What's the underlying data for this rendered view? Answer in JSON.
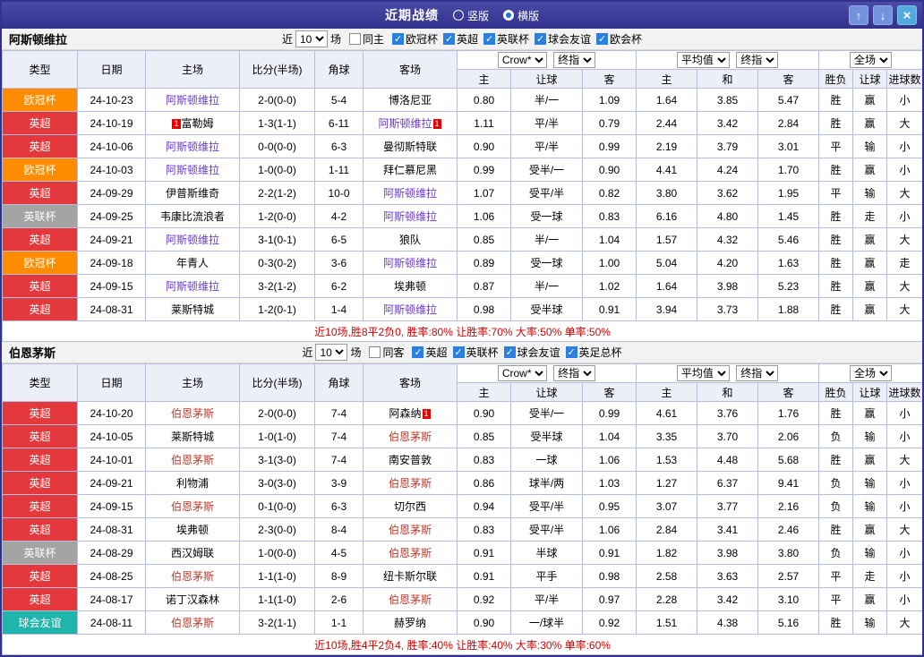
{
  "titlebar": {
    "title": "近期战绩",
    "radios": [
      {
        "label": "竖版",
        "checked": false
      },
      {
        "label": "横版",
        "checked": true
      }
    ],
    "icons": {
      "up": "↑",
      "down": "↓",
      "close": "×"
    }
  },
  "headers": {
    "type": "类型",
    "date": "日期",
    "home": "主场",
    "score": "比分(半场)",
    "corner": "角球",
    "away": "客场",
    "odds_home": "主",
    "odds_handicap": "让球",
    "odds_away": "客",
    "avg_home": "主",
    "avg_draw": "和",
    "avg_away": "客",
    "res_wl": "胜负",
    "res_handicap": "让球",
    "res_goals": "进球数"
  },
  "type_colors": {
    "欧冠杯": "#ff8c00",
    "英超": "#e4393c",
    "英联杯": "#a4a4a4",
    "球会友谊": "#1fb5ad"
  },
  "result_colors": {
    "r": "#e60012",
    "b": "#1330cc",
    "g": "#009933"
  },
  "sections": [
    {
      "team": "阿斯顿维拉",
      "team_color": "#6a3bd0",
      "filter": {
        "near_label": "近",
        "count": "10",
        "games_label": "场",
        "same_label": "同主",
        "same_checked": false,
        "leagues": [
          {
            "label": "欧冠杯",
            "checked": true
          },
          {
            "label": "英超",
            "checked": true
          },
          {
            "label": "英联杯",
            "checked": true
          },
          {
            "label": "球会友谊",
            "checked": true
          },
          {
            "label": "欧会杯",
            "checked": true
          }
        ]
      },
      "dropdowns": {
        "source": "Crow*",
        "source_time": "终指",
        "avg": "平均值",
        "avg_time": "终指",
        "scope": "全场"
      },
      "rows": [
        {
          "type": "欧冠杯",
          "date": "24-10-23",
          "home": {
            "n": "阿斯顿维拉",
            "f": 1
          },
          "score": "2-0(0-0)",
          "sc": "r",
          "corner": "5-4",
          "away": {
            "n": "博洛尼亚"
          },
          "odds": [
            "0.80",
            "半/一",
            "1.09"
          ],
          "avg": [
            "1.64",
            "3.85",
            "5.47"
          ],
          "res": [
            [
              "胜",
              "r"
            ],
            [
              "赢",
              "r"
            ],
            [
              "小",
              "b"
            ]
          ]
        },
        {
          "type": "英超",
          "date": "24-10-19",
          "home": {
            "n": "富勒姆",
            "rc": "1",
            "rcpos": "l"
          },
          "score": "1-3(1-1)",
          "sc": "r",
          "corner": "6-11",
          "away": {
            "n": "阿斯顿维拉",
            "f": 1,
            "rc": "1",
            "rcpos": "r"
          },
          "odds": [
            "1.11",
            "平/半",
            "0.79"
          ],
          "avg": [
            "2.44",
            "3.42",
            "2.84"
          ],
          "res": [
            [
              "胜",
              "r"
            ],
            [
              "赢",
              "r"
            ],
            [
              "大",
              "r"
            ]
          ]
        },
        {
          "type": "英超",
          "date": "24-10-06",
          "home": {
            "n": "阿斯顿维拉",
            "f": 1
          },
          "score": "0-0(0-0)",
          "sc": "b",
          "corner": "6-3",
          "away": {
            "n": "曼彻斯特联"
          },
          "odds": [
            "0.90",
            "平/半",
            "0.99"
          ],
          "avg": [
            "2.19",
            "3.79",
            "3.01"
          ],
          "res": [
            [
              "平",
              "b"
            ],
            [
              "输",
              "b"
            ],
            [
              "小",
              "b"
            ]
          ]
        },
        {
          "type": "欧冠杯",
          "date": "24-10-03",
          "home": {
            "n": "阿斯顿维拉",
            "f": 1
          },
          "score": "1-0(0-0)",
          "sc": "r",
          "corner": "1-11",
          "away": {
            "n": "拜仁慕尼黑"
          },
          "odds": [
            "0.99",
            "受半/一",
            "0.90"
          ],
          "avg": [
            "4.41",
            "4.24",
            "1.70"
          ],
          "res": [
            [
              "胜",
              "r"
            ],
            [
              "赢",
              "r"
            ],
            [
              "小",
              "b"
            ]
          ]
        },
        {
          "type": "英超",
          "date": "24-09-29",
          "home": {
            "n": "伊普斯维奇"
          },
          "score": "2-2(1-2)",
          "sc": "b",
          "corner": "10-0",
          "away": {
            "n": "阿斯顿维拉",
            "f": 1
          },
          "odds": [
            "1.07",
            "受平/半",
            "0.82"
          ],
          "avg": [
            "3.80",
            "3.62",
            "1.95"
          ],
          "res": [
            [
              "平",
              "b"
            ],
            [
              "输",
              "b"
            ],
            [
              "大",
              "r"
            ]
          ]
        },
        {
          "type": "英联杯",
          "date": "24-09-25",
          "home": {
            "n": "韦康比流浪者"
          },
          "score": "1-2(0-0)",
          "sc": "r",
          "corner": "4-2",
          "away": {
            "n": "阿斯顿维拉",
            "f": 1
          },
          "odds": [
            "1.06",
            "受一球",
            "0.83"
          ],
          "avg": [
            "6.16",
            "4.80",
            "1.45"
          ],
          "res": [
            [
              "胜",
              "r"
            ],
            [
              "走",
              "g"
            ],
            [
              "小",
              "b"
            ]
          ]
        },
        {
          "type": "英超",
          "date": "24-09-21",
          "home": {
            "n": "阿斯顿维拉",
            "f": 1
          },
          "score": "3-1(0-1)",
          "sc": "r",
          "corner": "6-5",
          "away": {
            "n": "狼队"
          },
          "odds": [
            "0.85",
            "半/一",
            "1.04"
          ],
          "avg": [
            "1.57",
            "4.32",
            "5.46"
          ],
          "res": [
            [
              "胜",
              "r"
            ],
            [
              "赢",
              "r"
            ],
            [
              "大",
              "r"
            ]
          ]
        },
        {
          "type": "欧冠杯",
          "date": "24-09-18",
          "home": {
            "n": "年青人"
          },
          "score": "0-3(0-2)",
          "sc": "r",
          "corner": "3-6",
          "away": {
            "n": "阿斯顿维拉",
            "f": 1
          },
          "odds": [
            "0.89",
            "受一球",
            "1.00"
          ],
          "avg": [
            "5.04",
            "4.20",
            "1.63"
          ],
          "res": [
            [
              "胜",
              "r"
            ],
            [
              "赢",
              "r"
            ],
            [
              "走",
              "g"
            ]
          ]
        },
        {
          "type": "英超",
          "date": "24-09-15",
          "home": {
            "n": "阿斯顿维拉",
            "f": 1
          },
          "score": "3-2(1-2)",
          "sc": "r",
          "corner": "6-2",
          "away": {
            "n": "埃弗顿"
          },
          "odds": [
            "0.87",
            "半/一",
            "1.02"
          ],
          "avg": [
            "1.64",
            "3.98",
            "5.23"
          ],
          "res": [
            [
              "胜",
              "r"
            ],
            [
              "赢",
              "r"
            ],
            [
              "大",
              "r"
            ]
          ]
        },
        {
          "type": "英超",
          "date": "24-08-31",
          "home": {
            "n": "莱斯特城"
          },
          "score": "1-2(0-1)",
          "sc": "r",
          "corner": "1-4",
          "away": {
            "n": "阿斯顿维拉",
            "f": 1
          },
          "odds": [
            "0.98",
            "受半球",
            "0.91"
          ],
          "avg": [
            "3.94",
            "3.73",
            "1.88"
          ],
          "res": [
            [
              "胜",
              "r"
            ],
            [
              "赢",
              "r"
            ],
            [
              "大",
              "r"
            ]
          ]
        }
      ],
      "summary": "近10场,胜8平2负0, 胜率:80% 让胜率:70% 大率:50% 单率:50%"
    },
    {
      "team": "伯恩茅斯",
      "team_color": "#c0392b",
      "filter": {
        "near_label": "近",
        "count": "10",
        "games_label": "场",
        "same_label": "同客",
        "same_checked": false,
        "leagues": [
          {
            "label": "英超",
            "checked": true
          },
          {
            "label": "英联杯",
            "checked": true
          },
          {
            "label": "球会友谊",
            "checked": true
          },
          {
            "label": "英足总杯",
            "checked": true
          }
        ]
      },
      "dropdowns": {
        "source": "Crow*",
        "source_time": "终指",
        "avg": "平均值",
        "avg_time": "终指",
        "scope": "全场"
      },
      "rows": [
        {
          "type": "英超",
          "date": "24-10-20",
          "home": {
            "n": "伯恩茅斯",
            "f": 1
          },
          "score": "2-0(0-0)",
          "sc": "r",
          "corner": "7-4",
          "away": {
            "n": "阿森纳",
            "rc": "1",
            "rcpos": "r"
          },
          "odds": [
            "0.90",
            "受半/一",
            "0.99"
          ],
          "avg": [
            "4.61",
            "3.76",
            "1.76"
          ],
          "res": [
            [
              "胜",
              "r"
            ],
            [
              "赢",
              "r"
            ],
            [
              "小",
              "b"
            ]
          ]
        },
        {
          "type": "英超",
          "date": "24-10-05",
          "home": {
            "n": "莱斯特城"
          },
          "score": "1-0(1-0)",
          "sc": "r",
          "corner": "7-4",
          "away": {
            "n": "伯恩茅斯",
            "f": 1
          },
          "odds": [
            "0.85",
            "受半球",
            "1.04"
          ],
          "avg": [
            "3.35",
            "3.70",
            "2.06"
          ],
          "res": [
            [
              "负",
              "b"
            ],
            [
              "输",
              "b"
            ],
            [
              "小",
              "b"
            ]
          ]
        },
        {
          "type": "英超",
          "date": "24-10-01",
          "home": {
            "n": "伯恩茅斯",
            "f": 1
          },
          "score": "3-1(3-0)",
          "sc": "r",
          "corner": "7-4",
          "away": {
            "n": "南安普敦"
          },
          "odds": [
            "0.83",
            "一球",
            "1.06"
          ],
          "avg": [
            "1.53",
            "4.48",
            "5.68"
          ],
          "res": [
            [
              "胜",
              "r"
            ],
            [
              "赢",
              "r"
            ],
            [
              "大",
              "r"
            ]
          ]
        },
        {
          "type": "英超",
          "date": "24-09-21",
          "home": {
            "n": "利物浦"
          },
          "score": "3-0(3-0)",
          "sc": "r",
          "corner": "3-9",
          "away": {
            "n": "伯恩茅斯",
            "f": 1
          },
          "odds": [
            "0.86",
            "球半/两",
            "1.03"
          ],
          "avg": [
            "1.27",
            "6.37",
            "9.41"
          ],
          "res": [
            [
              "负",
              "b"
            ],
            [
              "输",
              "b"
            ],
            [
              "小",
              "b"
            ]
          ]
        },
        {
          "type": "英超",
          "date": "24-09-15",
          "home": {
            "n": "伯恩茅斯",
            "f": 1
          },
          "score": "0-1(0-0)",
          "sc": "r",
          "corner": "6-3",
          "away": {
            "n": "切尔西"
          },
          "odds": [
            "0.94",
            "受平/半",
            "0.95"
          ],
          "avg": [
            "3.07",
            "3.77",
            "2.16"
          ],
          "res": [
            [
              "负",
              "b"
            ],
            [
              "输",
              "b"
            ],
            [
              "小",
              "b"
            ]
          ]
        },
        {
          "type": "英超",
          "date": "24-08-31",
          "home": {
            "n": "埃弗顿"
          },
          "score": "2-3(0-0)",
          "sc": "r",
          "corner": "8-4",
          "away": {
            "n": "伯恩茅斯",
            "f": 1
          },
          "odds": [
            "0.83",
            "受平/半",
            "1.06"
          ],
          "avg": [
            "2.84",
            "3.41",
            "2.46"
          ],
          "res": [
            [
              "胜",
              "r"
            ],
            [
              "赢",
              "r"
            ],
            [
              "大",
              "r"
            ]
          ]
        },
        {
          "type": "英联杯",
          "date": "24-08-29",
          "home": {
            "n": "西汉姆联"
          },
          "score": "1-0(0-0)",
          "sc": "r",
          "corner": "4-5",
          "away": {
            "n": "伯恩茅斯",
            "f": 1
          },
          "odds": [
            "0.91",
            "半球",
            "0.91"
          ],
          "avg": [
            "1.82",
            "3.98",
            "3.80"
          ],
          "res": [
            [
              "负",
              "b"
            ],
            [
              "输",
              "b"
            ],
            [
              "小",
              "b"
            ]
          ]
        },
        {
          "type": "英超",
          "date": "24-08-25",
          "home": {
            "n": "伯恩茅斯",
            "f": 1
          },
          "score": "1-1(1-0)",
          "sc": "b",
          "corner": "8-9",
          "away": {
            "n": "纽卡斯尔联"
          },
          "odds": [
            "0.91",
            "平手",
            "0.98"
          ],
          "avg": [
            "2.58",
            "3.63",
            "2.57"
          ],
          "res": [
            [
              "平",
              "b"
            ],
            [
              "走",
              "g"
            ],
            [
              "小",
              "b"
            ]
          ]
        },
        {
          "type": "英超",
          "date": "24-08-17",
          "home": {
            "n": "诺丁汉森林"
          },
          "score": "1-1(1-0)",
          "sc": "b",
          "corner": "2-6",
          "away": {
            "n": "伯恩茅斯",
            "f": 1
          },
          "odds": [
            "0.92",
            "平/半",
            "0.97"
          ],
          "avg": [
            "2.28",
            "3.42",
            "3.10"
          ],
          "res": [
            [
              "平",
              "b"
            ],
            [
              "赢",
              "r"
            ],
            [
              "小",
              "b"
            ]
          ]
        },
        {
          "type": "球会友谊",
          "date": "24-08-11",
          "home": {
            "n": "伯恩茅斯",
            "f": 1
          },
          "score": "3-2(1-1)",
          "sc": "r",
          "corner": "1-1",
          "away": {
            "n": "赫罗纳"
          },
          "odds": [
            "0.90",
            "一/球半",
            "0.92"
          ],
          "avg": [
            "1.51",
            "4.38",
            "5.16"
          ],
          "res": [
            [
              "胜",
              "r"
            ],
            [
              "输",
              "b"
            ],
            [
              "大",
              "r"
            ]
          ]
        }
      ],
      "summary": "近10场,胜4平2负4, 胜率:40% 让胜率:40% 大率:30% 单率:60%"
    }
  ]
}
